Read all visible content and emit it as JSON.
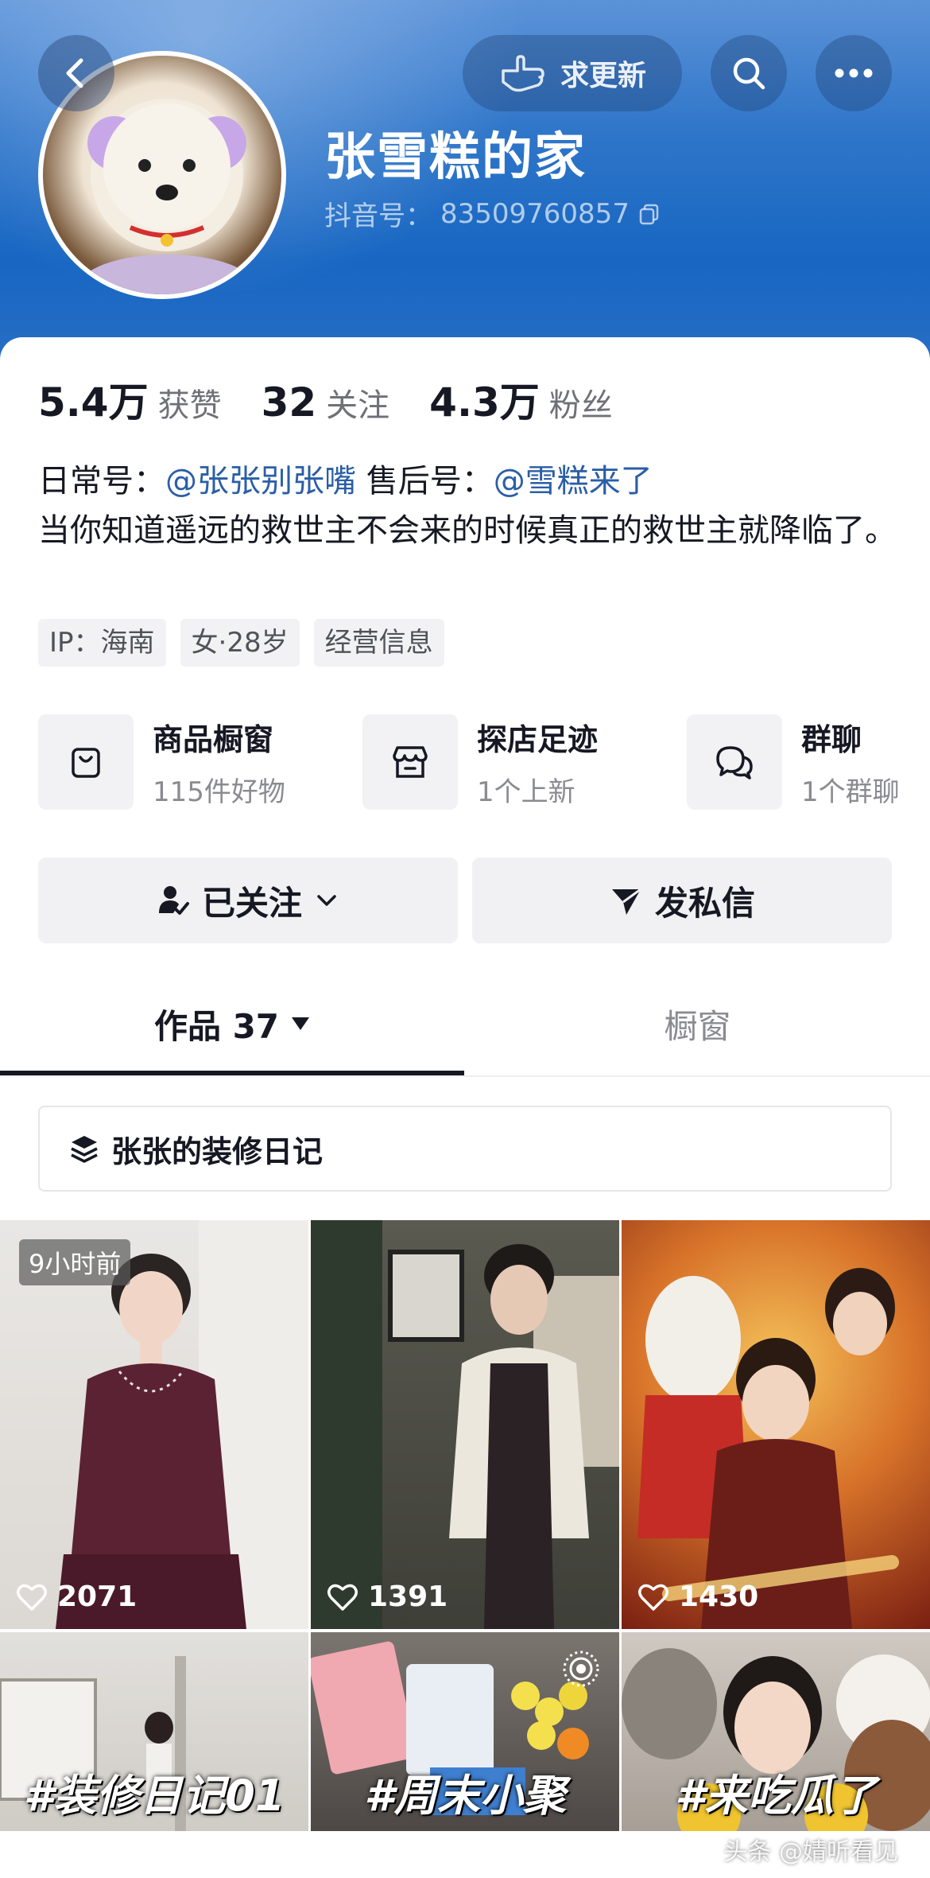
{
  "header": {
    "request_update_label": "求更新",
    "name": "张雪糕的家",
    "douyin_id_label": "抖音号：",
    "douyin_id": "83509760857"
  },
  "stats": [
    {
      "num": "5.4万",
      "label": "获赞"
    },
    {
      "num": "32",
      "label": "关注"
    },
    {
      "num": "4.3万",
      "label": "粉丝"
    }
  ],
  "bio": {
    "daily_label": "日常号：",
    "daily_link": "@张张别张嘴",
    "aftersale_label": "售后号：",
    "aftersale_link": "@雪糕来了",
    "text": "当你知道遥远的救世主不会来的时候真正的救世主就降临了。"
  },
  "tags": [
    "IP：海南",
    "女·28岁",
    "经营信息"
  ],
  "features": [
    {
      "title": "商品橱窗",
      "sub": "115件好物",
      "icon": "bag-icon"
    },
    {
      "title": "探店足迹",
      "sub": "1个上新",
      "icon": "store-icon"
    },
    {
      "title": "群聊",
      "sub": "1个群聊",
      "icon": "chat-icon"
    }
  ],
  "actions": {
    "follow_label": "已关注",
    "message_label": "发私信"
  },
  "tabs": {
    "works_label": "作品 37",
    "shop_label": "橱窗"
  },
  "collection_label": "张张的装修日记",
  "videos": [
    {
      "time_badge": "9小时前",
      "likes": "2071"
    },
    {
      "likes": "1391"
    },
    {
      "likes": "1430"
    },
    {
      "caption": "#装修日记01"
    },
    {
      "caption": "#周末小聚"
    },
    {
      "caption": "#来吃瓜了"
    }
  ],
  "watermark": "头条 @婧听看见",
  "colors": {
    "header_blue": "#1766c2",
    "link_blue": "#2b5ea6",
    "text_primary": "#161823",
    "text_secondary": "#8a8b91"
  }
}
